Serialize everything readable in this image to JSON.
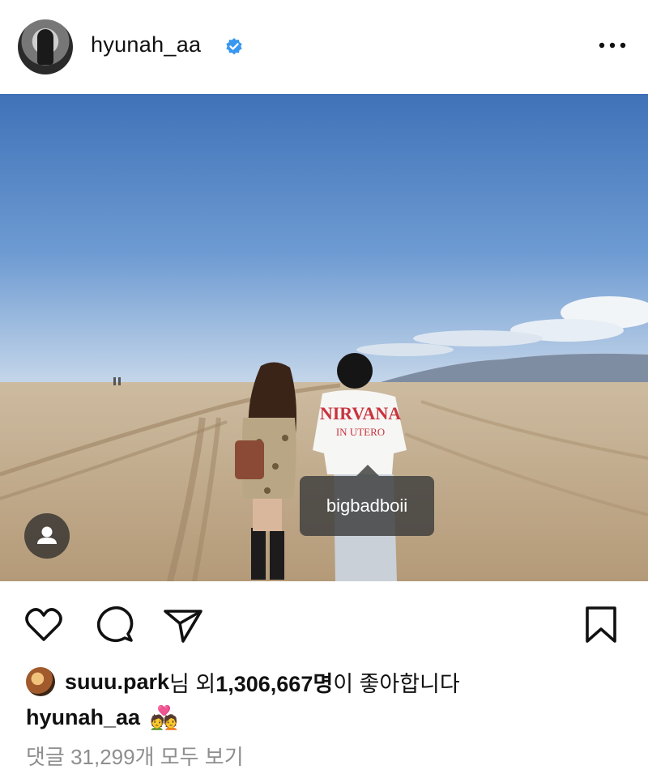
{
  "post": {
    "username": "hyunah_aa",
    "more_icon": "more-dots-icon",
    "verified_icon": "verified-badge-icon"
  },
  "photo": {
    "tag_label": "bigbadboii",
    "shirt_text_1": "NIRVANA",
    "shirt_text_2": "IN UTERO",
    "user_tag_icon": "person-icon"
  },
  "actions": {
    "like_icon": "heart-icon",
    "comment_icon": "comment-icon",
    "share_icon": "send-icon",
    "save_icon": "bookmark-icon"
  },
  "likes": {
    "first_user": "suuu.park",
    "text_a": "님 외 ",
    "count": "1,306,667명",
    "text_b": "이 좋아합니다"
  },
  "caption": {
    "username": "hyunah_aa",
    "emoji": "💑"
  },
  "comments": {
    "view_all": "댓글 31,299개 모두 보기"
  },
  "colors": {
    "verified": "#3897f0",
    "sky_top": "#3f72b8",
    "sand": "#c7b295"
  }
}
